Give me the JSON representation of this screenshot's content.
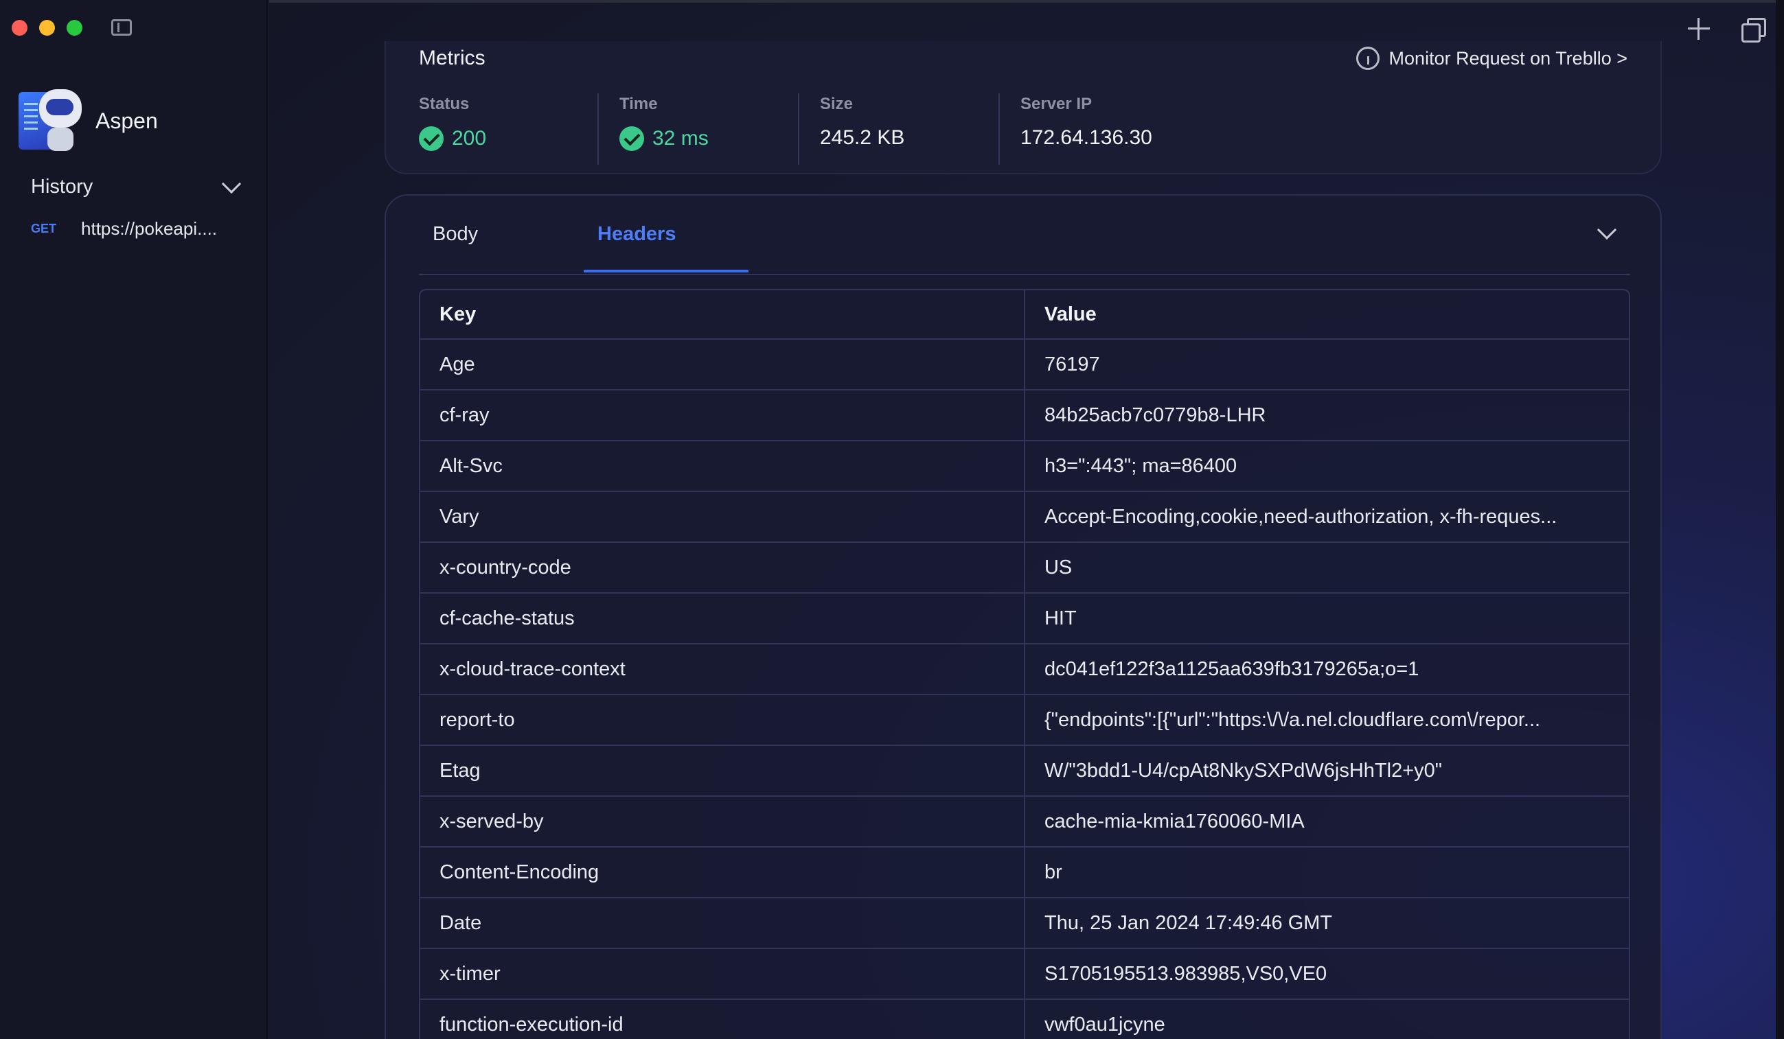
{
  "app": {
    "name": "Aspen"
  },
  "sidebar": {
    "history_title": "History",
    "items": [
      {
        "method": "GET",
        "url": "https://pokeapi...."
      }
    ]
  },
  "metrics": {
    "title": "Metrics",
    "monitor_link": "Monitor Request on Trebllo >",
    "items": [
      {
        "label": "Status",
        "value": "200"
      },
      {
        "label": "Time",
        "value": "32 ms"
      },
      {
        "label": "Size",
        "value": "245.2 KB"
      },
      {
        "label": "Server IP",
        "value": "172.64.136.30"
      }
    ]
  },
  "response": {
    "tabs": [
      {
        "label": "Body",
        "active": false
      },
      {
        "label": "Headers",
        "active": true
      }
    ],
    "table": {
      "columns": [
        "Key",
        "Value"
      ],
      "rows": [
        [
          "Age",
          "76197"
        ],
        [
          "cf-ray",
          "84b25acb7c0779b8-LHR"
        ],
        [
          "Alt-Svc",
          "h3=\":443\"; ma=86400"
        ],
        [
          "Vary",
          "Accept-Encoding,cookie,need-authorization, x-fh-reques..."
        ],
        [
          "x-country-code",
          "US"
        ],
        [
          "cf-cache-status",
          "HIT"
        ],
        [
          "x-cloud-trace-context",
          "dc041ef122f3a1125aa639fb3179265a;o=1"
        ],
        [
          "report-to",
          "{\"endpoints\":[{\"url\":\"https:\\/\\/a.nel.cloudflare.com\\/repor..."
        ],
        [
          "Etag",
          "W/\"3bdd1-U4/cpAt8NkySXPdW6jsHhTl2+y0\""
        ],
        [
          "x-served-by",
          "cache-mia-kmia1760060-MIA"
        ],
        [
          "Content-Encoding",
          "br"
        ],
        [
          "Date",
          "Thu, 25 Jan 2024 17:49:46 GMT"
        ],
        [
          "x-timer",
          "S1705195513.983985,VS0,VE0"
        ],
        [
          "function-execution-id",
          "vwf0au1jcyne"
        ]
      ]
    }
  },
  "colors": {
    "accent": "#4e7df5",
    "success": "#3bc98b"
  }
}
